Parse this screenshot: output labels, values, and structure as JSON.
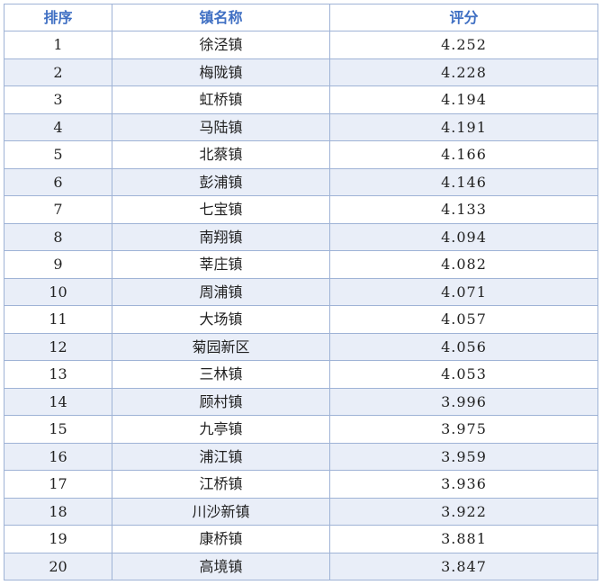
{
  "table": {
    "headers": [
      "排序",
      "镇名称",
      "评分"
    ],
    "rows": [
      {
        "rank": "1",
        "name": "徐泾镇",
        "score": "4.252"
      },
      {
        "rank": "2",
        "name": "梅陇镇",
        "score": "4.228"
      },
      {
        "rank": "3",
        "name": "虹桥镇",
        "score": "4.194"
      },
      {
        "rank": "4",
        "name": "马陆镇",
        "score": "4.191"
      },
      {
        "rank": "5",
        "name": "北蔡镇",
        "score": "4.166"
      },
      {
        "rank": "6",
        "name": "彭浦镇",
        "score": "4.146"
      },
      {
        "rank": "7",
        "name": "七宝镇",
        "score": "4.133"
      },
      {
        "rank": "8",
        "name": "南翔镇",
        "score": "4.094"
      },
      {
        "rank": "9",
        "name": "莘庄镇",
        "score": "4.082"
      },
      {
        "rank": "10",
        "name": "周浦镇",
        "score": "4.071"
      },
      {
        "rank": "11",
        "name": "大场镇",
        "score": "4.057"
      },
      {
        "rank": "12",
        "name": "菊园新区",
        "score": "4.056"
      },
      {
        "rank": "13",
        "name": "三林镇",
        "score": "4.053"
      },
      {
        "rank": "14",
        "name": "顾村镇",
        "score": "3.996"
      },
      {
        "rank": "15",
        "name": "九亭镇",
        "score": "3.975"
      },
      {
        "rank": "16",
        "name": "浦江镇",
        "score": "3.959"
      },
      {
        "rank": "17",
        "name": "江桥镇",
        "score": "3.936"
      },
      {
        "rank": "18",
        "name": "川沙新镇",
        "score": "3.922"
      },
      {
        "rank": "19",
        "name": "康桥镇",
        "score": "3.881"
      },
      {
        "rank": "20",
        "name": "高境镇",
        "score": "3.847"
      }
    ]
  },
  "colors": {
    "header_text": "#3f6fc3",
    "border": "#9fb3d6",
    "stripe": "#e9eef8"
  }
}
